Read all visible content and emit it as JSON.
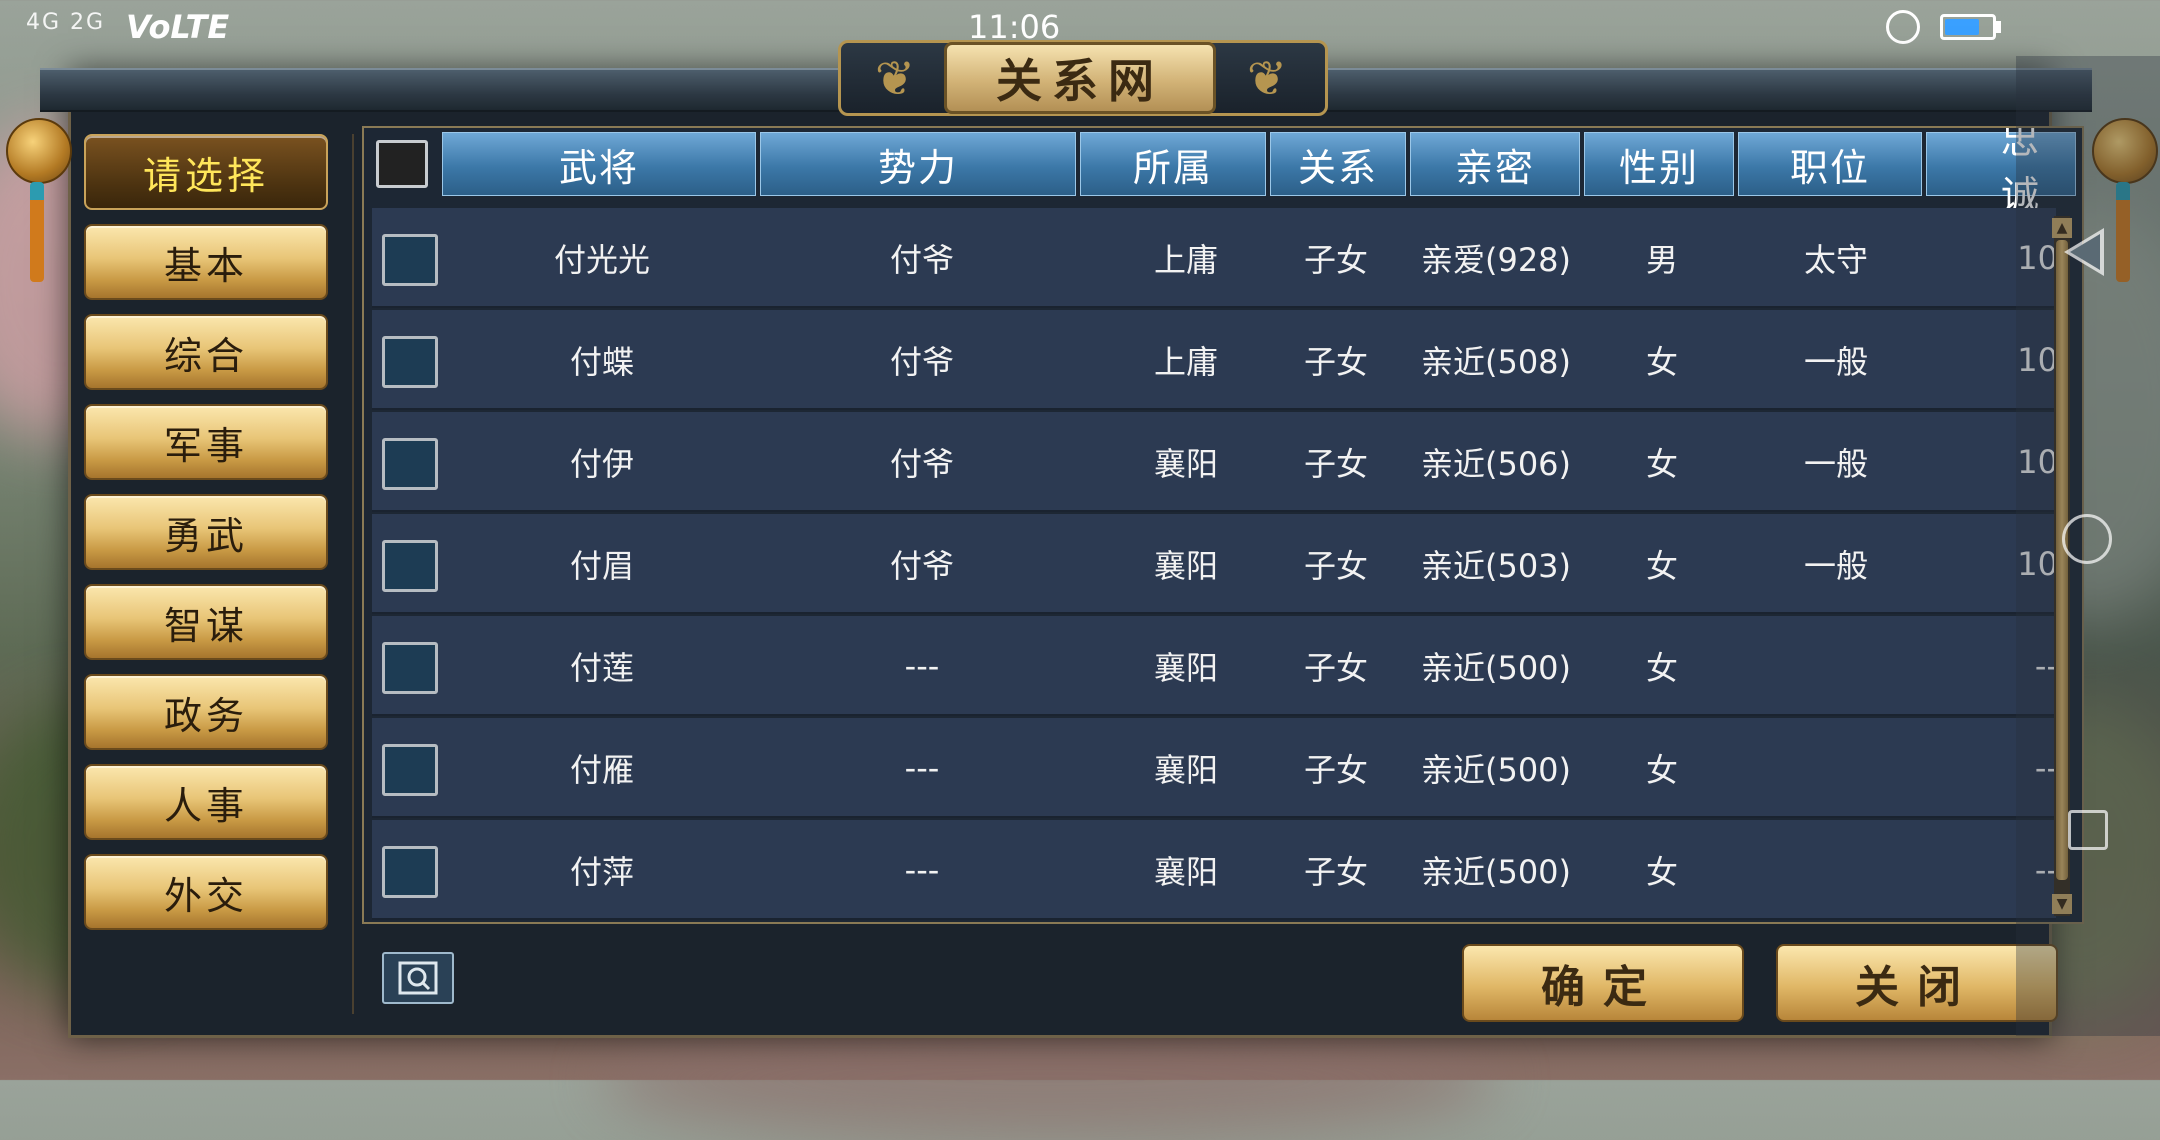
{
  "status_bar": {
    "signal": "4G 2G",
    "network": "VoLTE",
    "time": "11:06",
    "battery_level": 0.7
  },
  "dialog": {
    "title": "关系网"
  },
  "sidebar": {
    "items": [
      {
        "label": "请选择",
        "active": true
      },
      {
        "label": "基本"
      },
      {
        "label": "综合"
      },
      {
        "label": "军事"
      },
      {
        "label": "勇武"
      },
      {
        "label": "智谋"
      },
      {
        "label": "政务"
      },
      {
        "label": "人事"
      },
      {
        "label": "外交"
      }
    ]
  },
  "table": {
    "headers": [
      "武将",
      "势力",
      "所属",
      "关系",
      "亲密",
      "性别",
      "职位",
      "忠诚"
    ],
    "rows": [
      [
        "付光光",
        "付爷",
        "上庸",
        "子女",
        "亲爱(928)",
        "男",
        "太守",
        "10"
      ],
      [
        "付蝶",
        "付爷",
        "上庸",
        "子女",
        "亲近(508)",
        "女",
        "一般",
        "10"
      ],
      [
        "付伊",
        "付爷",
        "襄阳",
        "子女",
        "亲近(506)",
        "女",
        "一般",
        "10"
      ],
      [
        "付眉",
        "付爷",
        "襄阳",
        "子女",
        "亲近(503)",
        "女",
        "一般",
        "10"
      ],
      [
        "付莲",
        "---",
        "襄阳",
        "子女",
        "亲近(500)",
        "女",
        "",
        "--"
      ],
      [
        "付雁",
        "---",
        "襄阳",
        "子女",
        "亲近(500)",
        "女",
        "",
        "--"
      ],
      [
        "付萍",
        "---",
        "襄阳",
        "子女",
        "亲近(500)",
        "女",
        "",
        "--"
      ]
    ]
  },
  "buttons": {
    "confirm": "确定",
    "close": "关闭"
  },
  "icons": {
    "zoom": "magnifier-icon",
    "scroll_up": "▲",
    "scroll_down": "▼"
  },
  "colors": {
    "active_text": "#ffe65a",
    "header_blue": "#3c78a8",
    "row_bg": "#2c3a52"
  }
}
